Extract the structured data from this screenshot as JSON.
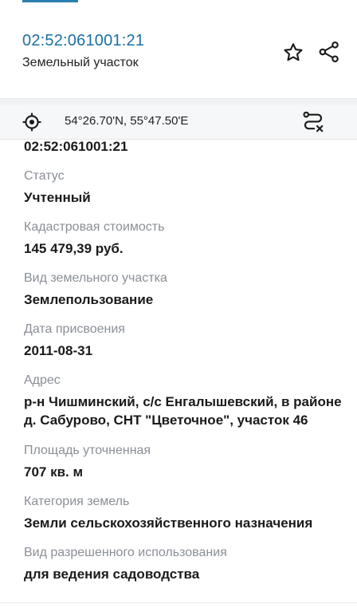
{
  "header": {
    "cadastral_number": "02:52:061001:21",
    "object_type": "Земельный участок"
  },
  "coords": {
    "text": "54°26.70'N, 55°47.50'E"
  },
  "details": {
    "cadastral_number_repeat": "02:52:061001:21",
    "fields": [
      {
        "label": "Статус",
        "value": "Учтенный"
      },
      {
        "label": "Кадастровая стоимость",
        "value": "145 479,39 руб."
      },
      {
        "label": "Вид земельного участка",
        "value": "Землепользование"
      },
      {
        "label": "Дата присвоения",
        "value": "2011-08-31"
      },
      {
        "label": "Адрес",
        "value": "р-н Чишминский, с/с Енгалышевский, в районе д. Сабурово, СНТ \"Цветочное\", участок 46"
      },
      {
        "label": "Площадь уточненная",
        "value": "707 кв. м"
      },
      {
        "label": "Категория земель",
        "value": "Земли сельскохозяйственного назначения"
      },
      {
        "label": "Вид разрешенного использования",
        "value": "для ведения садоводства"
      }
    ]
  },
  "icons": {
    "favorite": "star-outline-icon",
    "share": "share-icon",
    "locate": "crosshair-icon",
    "route": "route-icon"
  },
  "colors": {
    "accent": "#1a6fa3",
    "label": "#8a8f96",
    "value": "#1a1a1a"
  }
}
